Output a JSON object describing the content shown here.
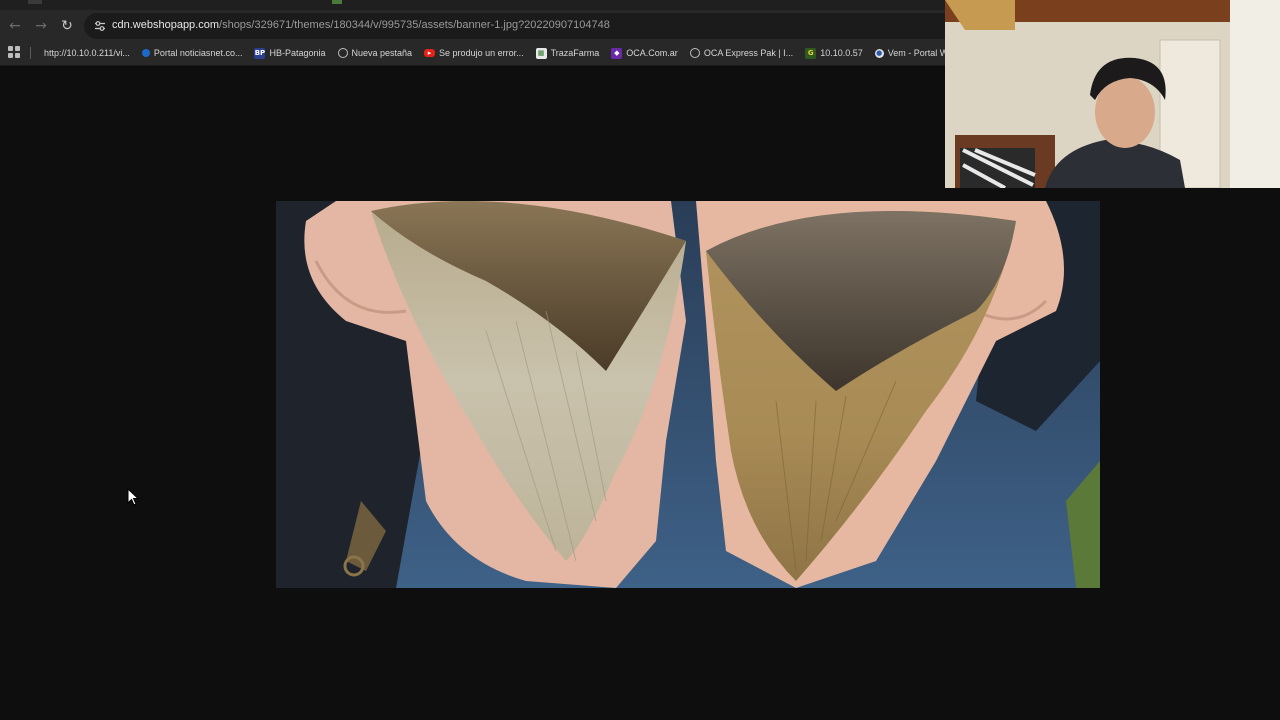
{
  "browser": {
    "back_icon": "arrow-left-icon",
    "forward_icon": "arrow-right-icon",
    "reload_icon": "reload-icon",
    "site_info_icon": "tune-icon",
    "url_host": "cdn.webshopapp.com",
    "url_path": "/shops/329671/themes/180344/v/995735/assets/banner-1.jpg?20220907104748"
  },
  "bookmarks": [
    {
      "label": "http://10.10.0.211/vi...",
      "icon": "page-icon",
      "color": "#888888"
    },
    {
      "label": "Portal noticiasnet.co...",
      "icon": "edge-icon",
      "color": "#1b6ac9"
    },
    {
      "label": "HB-Patagonia",
      "icon": "bp-icon",
      "color": "#2a3f8f"
    },
    {
      "label": "Nueva pestaña",
      "icon": "globe-icon",
      "color": "#9a9a9a"
    },
    {
      "label": "Se produjo un error...",
      "icon": "youtube-icon",
      "color": "#e62117"
    },
    {
      "label": "TrazaFarma",
      "icon": "sheet-icon",
      "color": "#d8d8d8"
    },
    {
      "label": "OCA.Com.ar",
      "icon": "oca-icon",
      "color": "#6a2aa8"
    },
    {
      "label": "OCA Express Pak | I...",
      "icon": "globe-icon",
      "color": "#9a9a9a"
    },
    {
      "label": "10.10.0.57",
      "icon": "grid-icon",
      "color": "#c9a227"
    },
    {
      "label": "Vem - Portal Web",
      "icon": "vem-icon",
      "color": "#e0e0e0"
    }
  ]
}
